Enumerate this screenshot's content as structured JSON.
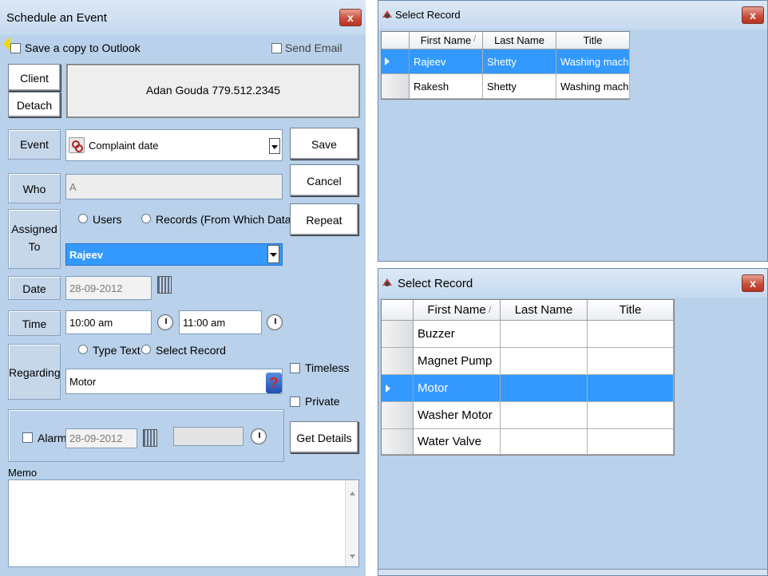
{
  "schedule": {
    "title": "Schedule an Event",
    "close_glyph": "x",
    "save_copy_label": "Save a copy to Outlook",
    "send_email_label": "Send Email",
    "client_label": "Client",
    "detach_label": "Detach",
    "client_info": "Adan Gouda 779.512.2345",
    "event_label": "Event",
    "event_value": "Complaint date",
    "who_label": "Who",
    "who_value": "A",
    "assigned_label_1": "Assigned",
    "assigned_label_2": "To",
    "users_label": "Users",
    "records_label": "Records (From Which Database)",
    "assigned_value": "Rajeev",
    "date_label": "Date",
    "date_value": "28-09-2012",
    "time_label": "Time",
    "time_start": "10:00 am",
    "time_end": "11:00 am",
    "regarding_label": "Regarding",
    "type_text_label": "Type Text",
    "select_record_label": "Select Record",
    "regarding_value": "Motor",
    "timeless_label": "Timeless",
    "private_label": "Private",
    "alarm_label": "Alarm",
    "alarm_date": "28-09-2012",
    "alarm_time": "",
    "save_label": "Save",
    "cancel_label": "Cancel",
    "repeat_label": "Repeat",
    "get_details_label": "Get Details",
    "memo_label": "Memo",
    "memo_value": "",
    "help_glyph": "?"
  },
  "select_record_top": {
    "title": "Select Record",
    "close_glyph": "x",
    "columns": [
      "First Name",
      "Last Name",
      "Title"
    ],
    "sort_glyph": "/",
    "rows": [
      [
        "Rajeev",
        "Shetty",
        "Washing machin..."
      ],
      [
        "Rakesh",
        "Shetty",
        "Washing machin..."
      ]
    ],
    "selected_row": 0
  },
  "select_record_bottom": {
    "title": "Select Record",
    "close_glyph": "x",
    "columns": [
      "First Name",
      "Last Name",
      "Title"
    ],
    "sort_glyph": "/",
    "rows": [
      [
        "Buzzer",
        "",
        ""
      ],
      [
        "Magnet Pump",
        "",
        ""
      ],
      [
        "Motor",
        "",
        ""
      ],
      [
        "Washer Motor",
        "",
        ""
      ],
      [
        "Water Valve",
        "",
        ""
      ]
    ],
    "selected_row": 2
  },
  "colors": {
    "window_bg": "#b9d1ea",
    "selection": "#3399ff",
    "close_red": "#c8503c"
  }
}
